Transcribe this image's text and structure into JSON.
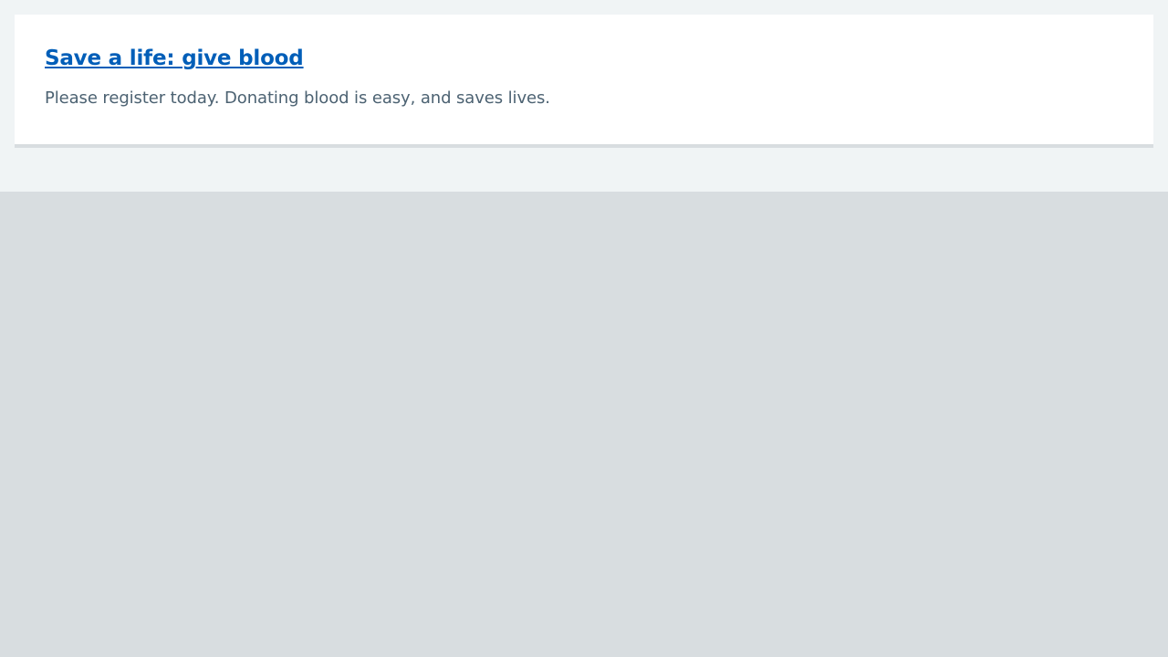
{
  "card": {
    "title": "Save a life: give blood",
    "description": "Please register today. Donating blood is easy, and saves lives."
  },
  "colors": {
    "link": "#005eb8",
    "text_secondary": "#4c6272",
    "band_background": "#f0f4f5",
    "page_background": "#d8dde0",
    "card_background": "#ffffff"
  }
}
